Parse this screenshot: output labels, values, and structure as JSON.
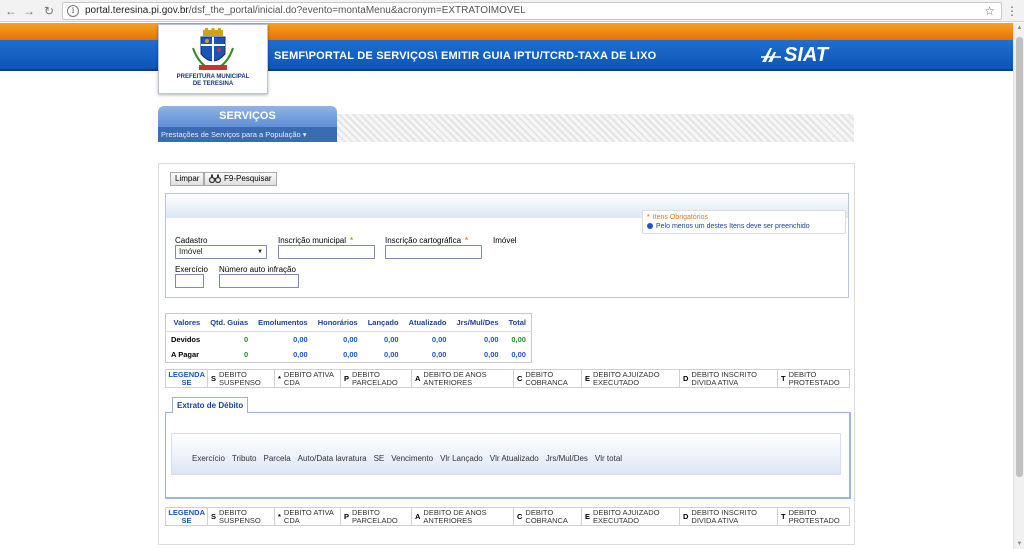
{
  "browser": {
    "url_host": "portal.teresina.pi.gov.br",
    "url_path": "/dsf_the_portal/inicial.do?evento=montaMenu&acronym=EXTRATOIMOVEL"
  },
  "header": {
    "title": "SEMF\\PORTAL DE SERVIÇOS\\  EMITIR GUIA IPTU/TCRD-TAXA DE LIXO",
    "logo_caption_1": "PREFEITURA MUNICIPAL",
    "logo_caption_2": "DE TERESINA",
    "siat": "SIAT"
  },
  "services": {
    "title": "SERVIÇOS",
    "subtitle": "Prestações de Serviços para a População"
  },
  "toolbar": {
    "limpar": "Limpar",
    "pesquisar": "F9-Pesquisar"
  },
  "legend_required": {
    "obrigatorios": "Itens Obrigatórios",
    "pelo_menos_um": "Pelo menos um destes Itens deve ser preenchido"
  },
  "form": {
    "cadastro_label": "Cadastro",
    "cadastro_value": "Imóvel",
    "inscricao_municipal_label": "Inscrição municipal",
    "inscricao_cartografica_label": "Inscrição cartográfica",
    "imovel_label": "Imóvel",
    "exercicio_label": "Exercício",
    "numero_auto_label": "Número auto infração"
  },
  "values_table": {
    "headers": [
      "Valores",
      "Qtd. Guias",
      "Emolumentos",
      "Honorários",
      "Lançado",
      "Atualizado",
      "Jrs/Mul/Des",
      "Total"
    ],
    "rows": [
      {
        "label": "Devidos",
        "cells": [
          "0",
          "0,00",
          "0,00",
          "0,00",
          "0,00",
          "0,00",
          "0,00"
        ]
      },
      {
        "label": "A Pagar",
        "cells": [
          "0",
          "0,00",
          "0,00",
          "0,00",
          "0,00",
          "0,00",
          "0,00"
        ]
      }
    ]
  },
  "legend": {
    "head": "LEGENDA SE",
    "items": [
      {
        "code": "S",
        "text": "DEBITO SUSPENSO"
      },
      {
        "code": "*",
        "text": "DEBITO ATIVA CDA"
      },
      {
        "code": "P",
        "text": "DEBITO PARCELADO"
      },
      {
        "code": "A",
        "text": "DEBITO DE ANOS ANTERIORES"
      },
      {
        "code": "C",
        "text": "DEBITO COBRANCA"
      },
      {
        "code": "E",
        "text": "DEBITO AJUIZADO EXECUTADO"
      },
      {
        "code": "D",
        "text": "DEBITO INSCRITO DIVIDA ATIVA"
      },
      {
        "code": "T",
        "text": "DEBITO PROTESTADO"
      }
    ]
  },
  "extrato": {
    "tab": "Extrato de Débito",
    "columns": [
      "Exercício",
      "Tributo",
      "Parcela",
      "Auto/Data lavratura",
      "SE",
      "Vencimento",
      "Vlr Lançado",
      "Vlr Atualizado",
      "Jrs/Mul/Des",
      "Vlr total"
    ]
  },
  "colors": {
    "header_blue": "#0b55b5",
    "header_orange": "#e3730d",
    "link_blue": "#1b3f9a",
    "value_green": "#2a8a2a"
  }
}
